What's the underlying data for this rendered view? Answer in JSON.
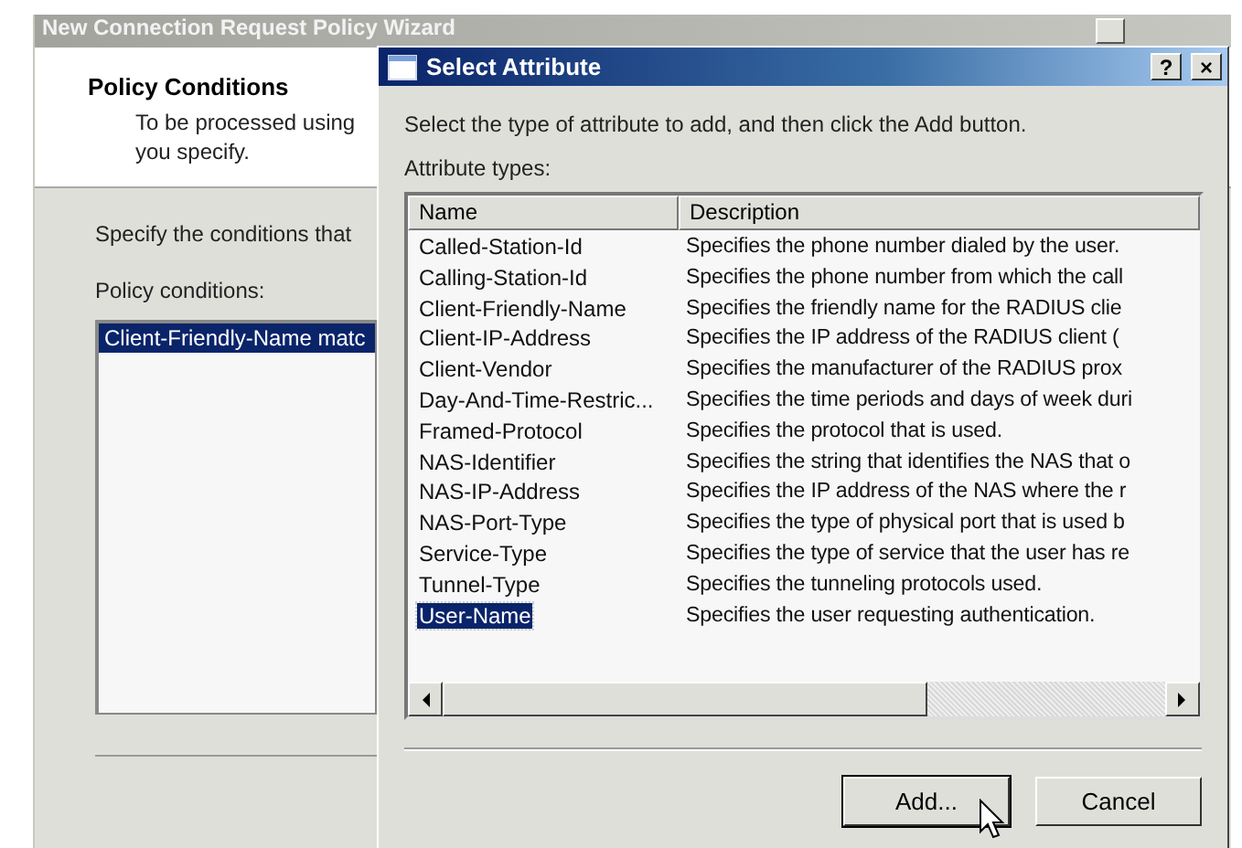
{
  "back_window": {
    "title": "New Connection Request Policy Wizard",
    "header_title": "Policy Conditions",
    "header_lines": [
      "To be processed using",
      "you specify."
    ],
    "intro": "Specify the conditions that",
    "list_label": "Policy conditions:",
    "conditions": [
      {
        "text": "Client-Friendly-Name matc",
        "selected": true
      }
    ]
  },
  "dialog": {
    "title": "Select Attribute",
    "help_button": "?",
    "close_button": "×",
    "instruction": "Select the type of attribute to add, and then click the Add button.",
    "list_label": "Attribute types:",
    "columns": [
      "Name",
      "Description"
    ],
    "rows": [
      {
        "name": "Called-Station-Id",
        "description": "Specifies the phone number dialed by the user.",
        "selected": false
      },
      {
        "name": "Calling-Station-Id",
        "description": "Specifies the phone number from which the call",
        "selected": false
      },
      {
        "name": "Client-Friendly-Name",
        "description": "Specifies the friendly name for the RADIUS clie",
        "selected": false
      },
      {
        "name": "Client-IP-Address",
        "description": "Specifies the IP address of the RADIUS client (",
        "selected": false
      },
      {
        "name": "Client-Vendor",
        "description": "Specifies the manufacturer of the RADIUS prox",
        "selected": false
      },
      {
        "name": "Day-And-Time-Restric...",
        "description": "Specifies the time periods and days of week duri",
        "selected": false
      },
      {
        "name": "Framed-Protocol",
        "description": "Specifies the protocol that is used.",
        "selected": false
      },
      {
        "name": "NAS-Identifier",
        "description": "Specifies the string that identifies the NAS that o",
        "selected": false
      },
      {
        "name": "NAS-IP-Address",
        "description": "Specifies the IP address of the NAS where the r",
        "selected": false
      },
      {
        "name": "NAS-Port-Type",
        "description": "Specifies the type of physical port that is used b",
        "selected": false
      },
      {
        "name": "Service-Type",
        "description": "Specifies the type of service that the user has re",
        "selected": false
      },
      {
        "name": "Tunnel-Type",
        "description": "Specifies the tunneling protocols used.",
        "selected": false
      },
      {
        "name": "User-Name",
        "description": "Specifies the user requesting authentication.",
        "selected": true
      }
    ],
    "buttons": [
      "Add...",
      "Cancel"
    ]
  }
}
